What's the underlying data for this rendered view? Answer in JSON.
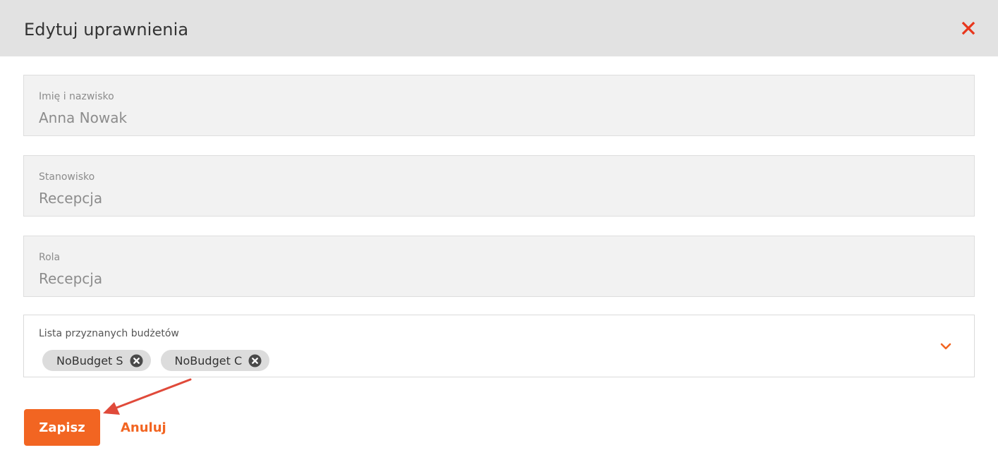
{
  "dialog": {
    "title": "Edytuj uprawnienia",
    "close_icon": "close-icon",
    "accent_color": "#f26522"
  },
  "form": {
    "name": {
      "label": "Imię i nazwisko",
      "value": "Anna Nowak"
    },
    "position": {
      "label": "Stanowisko",
      "value": "Recepcja"
    },
    "role": {
      "label": "Rola",
      "value": "Recepcja"
    },
    "budgets": {
      "label": "Lista przyznanych budżetów",
      "selected": [
        "NoBudget S",
        "NoBudget C"
      ],
      "remove_icon": "remove-circle-icon",
      "dropdown_icon": "chevron-down-icon"
    }
  },
  "actions": {
    "save_label": "Zapisz",
    "cancel_label": "Anuluj"
  }
}
